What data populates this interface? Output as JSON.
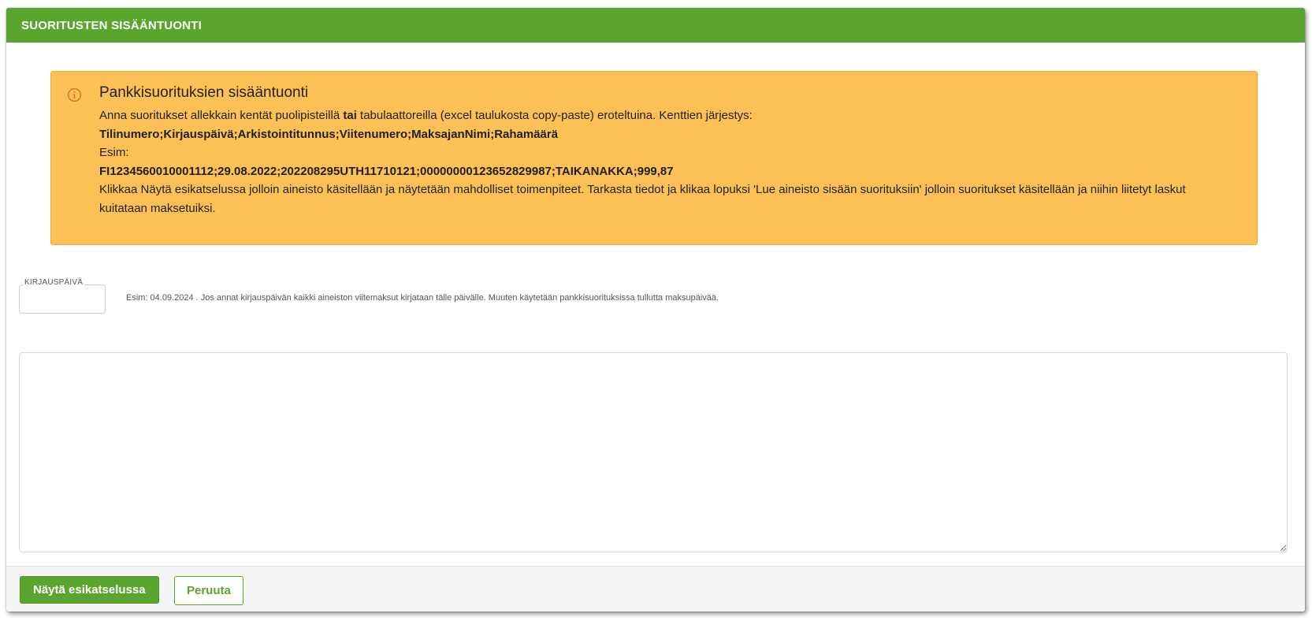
{
  "header": {
    "title": "SUORITUSTEN SISÄÄNTUONTI"
  },
  "colors": {
    "brand_green": "#5aa52d",
    "alert_background": "#fcc156",
    "alert_icon": "#e8702a"
  },
  "alert": {
    "icon": "info-circle-icon",
    "title": "Pankkisuorituksien sisääntuonti",
    "line1_pre": "Anna suoritukset allekkain kentät puolipisteillä ",
    "line1_bold": "tai",
    "line1_post": " tabulaattoreilla (excel taulukosta copy-paste) eroteltuina. Kenttien järjestys:",
    "fields_order": "Tilinumero;Kirjauspäivä;Arkistointitunnus;Viitenumero;MaksajanNimi;Rahamäärä",
    "example_label": "Esim:",
    "example_value": "FI1234560010001112;29.08.2022;202208295UTH11710121;00000000123652829987;TAIKANAKKA;999,87",
    "instructions": "Klikkaa Näytä esikatselussa jolloin aineisto käsitellään ja näytetään mahdolliset toimenpiteet. Tarkasta tiedot ja klikaa lopuksi 'Lue aineisto sisään suorituksiin' jolloin suoritukset käsitellään ja niihin liitetyt laskut kuitataan maksetuiksi."
  },
  "date_field": {
    "label": "KIRJAUSPÄIVÄ",
    "value": "",
    "hint": "Esim: 04.09.2024 . Jos annat kirjauspäivän kaikki aineiston viitemaksut kirjataan tälle päivälle. Muuten käytetään pankkisuorituksissa tullutta maksupäivää."
  },
  "data_textarea": {
    "value": ""
  },
  "footer": {
    "preview_label": "Näytä esikatselussa",
    "cancel_label": "Peruuta"
  }
}
